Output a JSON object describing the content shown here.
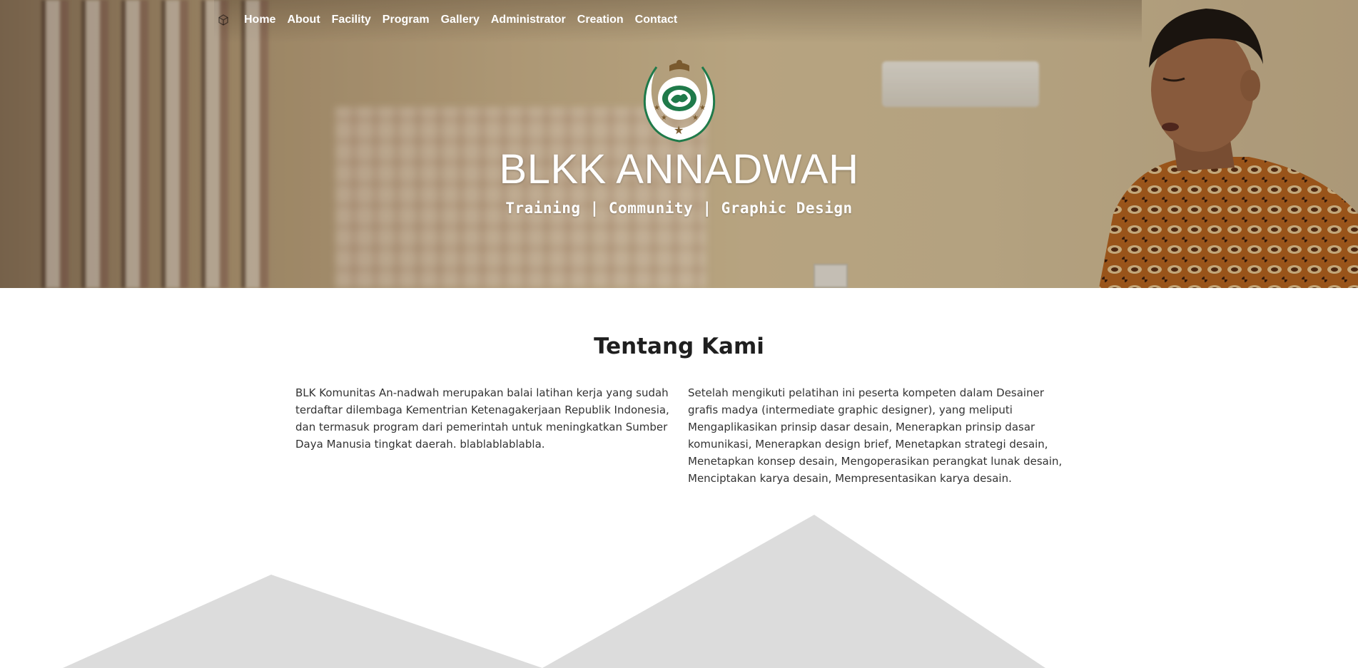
{
  "nav": {
    "brand_icon": "cube-icon",
    "items": [
      "Home",
      "About",
      "Facility",
      "Program",
      "Gallery",
      "Administrator",
      "Creation",
      "Contact"
    ]
  },
  "hero": {
    "title": "BLKK ANNADWAH",
    "subtitle": "Training | Community | Graphic Design",
    "logo_icon": "annadwah-crest-logo"
  },
  "about": {
    "title": "Tentang Kami",
    "left_text": "BLK Komunitas An-nadwah merupakan balai latihan kerja yang sudah terdaftar dilembaga Kementrian Ketenagakerjaan Republik Indonesia, dan termasuk program dari pemerintah untuk meningkatkan Sumber Daya Manusia tingkat daerah. blablablablabla.",
    "right_text": "Setelah mengikuti pelatihan ini peserta kompeten dalam Desainer grafis madya (intermediate graphic designer), yang meliputi Mengaplikasikan prinsip dasar desain, Menerapkan prinsip dasar komunikasi, Menerapkan design brief, Menetapkan strategi desain, Menetapkan konsep desain, Mengoperasikan perangkat lunak desain, Menciptakan karya desain, Mempresentasikan karya desain."
  },
  "colors": {
    "logo_green": "#1f7a4a",
    "logo_brown": "#7a5a2e",
    "mountain_gray": "#dcdcdc"
  }
}
